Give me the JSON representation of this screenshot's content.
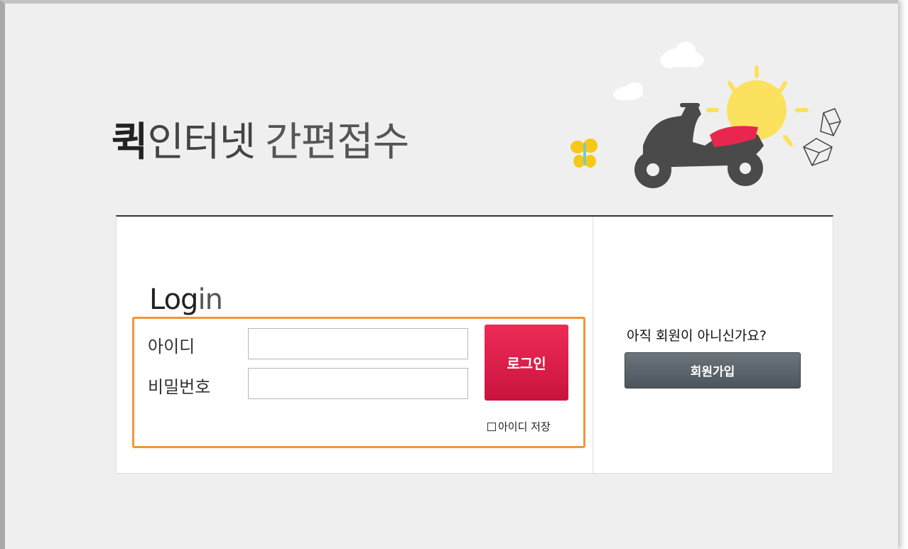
{
  "header": {
    "title_strong": "퀵",
    "title_rest": "인터넷",
    "title_light": "간편접수"
  },
  "login": {
    "heading_bold": "Log",
    "heading_thin": "in",
    "id_label": "아이디",
    "password_label": "비밀번호",
    "id_value": "",
    "password_value": "",
    "login_button": "로그인",
    "save_id_label": "아이디 저장",
    "save_id_checked": false
  },
  "signup": {
    "prompt": "아직 회원이 아니신가요?",
    "button": "회원가입"
  },
  "colors": {
    "accent_red": "#e0214d",
    "highlight_orange": "#f0963a",
    "signup_gray": "#5a6269",
    "sun_yellow": "#fbe15e"
  },
  "icons": [
    "scooter-icon",
    "sun-icon",
    "cloud-icon",
    "butterfly-icon",
    "box-icon"
  ]
}
